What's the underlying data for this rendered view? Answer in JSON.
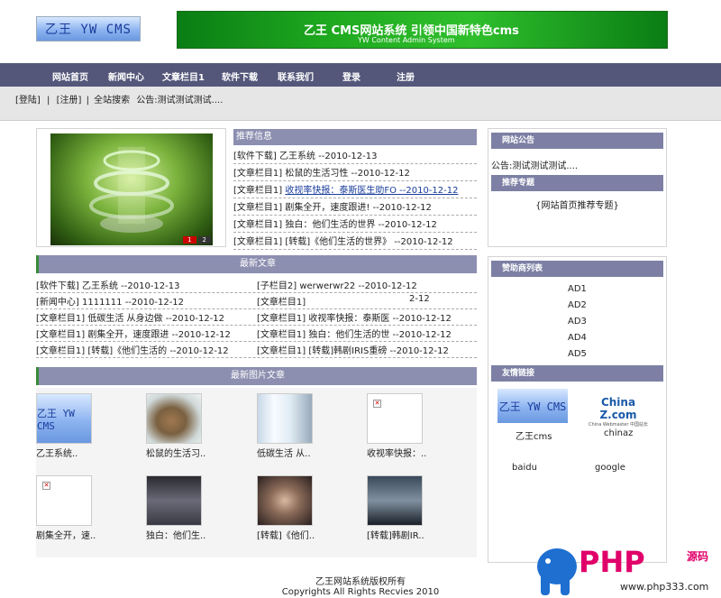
{
  "site": {
    "logo_text": "乙王 YW CMS",
    "banner_title": "乙王 CMS网站系统 引领中国新特色cms",
    "banner_sub": "YW Content Admin System"
  },
  "nav": [
    "网站首页",
    "新闻中心",
    "文章栏目1",
    "软件下载",
    "联系我们",
    "登录",
    "注册"
  ],
  "subbar": {
    "login": "[登陆]",
    "sep1": "|",
    "register": "[注册]",
    "sep2": "|",
    "search": "全站搜索",
    "notice": "公告:测试测试测试...."
  },
  "featured": {
    "slide_nums": [
      "1",
      "2"
    ],
    "header": "推荐信息",
    "items": [
      {
        "text": "[软件下载] 乙王系统 --2010-12-13"
      },
      {
        "text": "[文章栏目1] 松鼠的生活习性 --2010-12-12"
      },
      {
        "cat": "[文章栏目1] ",
        "link": "收视率快报：泰斯医生助FO --2010-12-12"
      },
      {
        "text": "[文章栏目1] 剧集全开，速度跟进! --2010-12-12"
      },
      {
        "text": "[文章栏目1] 独白：他们生活的世界 --2010-12-12"
      },
      {
        "text": "[文章栏目1] [转载]《他们生活的世界》 --2010-12-12"
      }
    ]
  },
  "latest": {
    "header": "最新文章",
    "left": [
      "[软件下载] 乙王系统 --2010-12-13",
      "[新闻中心] 1111111 --2010-12-12",
      "[文章栏目1] 低碳生活 从身边做 --2010-12-12",
      "[文章栏目1] 剧集全开，速度跟进 --2010-12-12",
      "[文章栏目1] [转载]《他们生活的 --2010-12-12"
    ],
    "right": [
      "[子栏目2] werwerwr22 --2010-12-12",
      "[文章栏目1]",
      "[文章栏目1] 收视率快报：泰斯医 --2010-12-12",
      "[文章栏目1] 独白：他们生活的世 --2010-12-12",
      "[文章栏目1] [转载]韩剧IRIS重磅 --2010-12-12"
    ],
    "right_date2": "2-12"
  },
  "photos": {
    "header": "最新图片文章",
    "row1": [
      "乙王系统..",
      "松鼠的生活习..",
      "低碳生活 从..",
      "收视率快报：.."
    ],
    "row2": [
      "剧集全开，速..",
      "独白：他们生..",
      "[转载]《他们..",
      "[转载]韩剧IR.."
    ],
    "thumb_logo": "乙王 YW CMS"
  },
  "sidebar": {
    "notice_header": "网站公告",
    "notice_text": "公告:测试测试测试....",
    "recommend_header": "推荐专题",
    "recommend_text": "{网站首页推荐专题}",
    "sponsor_header": "赞助商列表",
    "ads": [
      "AD1",
      "AD2",
      "AD3",
      "AD4",
      "AD5"
    ],
    "links_header": "友情链接",
    "link_logo1": "乙王 YW CMS",
    "link_logo2": "China Z.com",
    "link_logo2_sub": "China Webmaster 中国站长",
    "links": [
      "乙王cms",
      "chinaz",
      "baidu",
      "google"
    ]
  },
  "footer": {
    "line1": "乙王网站系统版权所有",
    "line2": "Copyrights All Rights Recvies 2010"
  },
  "watermark": {
    "php": "PHP",
    "yuan": "源码",
    "url": "www.php333.com"
  }
}
